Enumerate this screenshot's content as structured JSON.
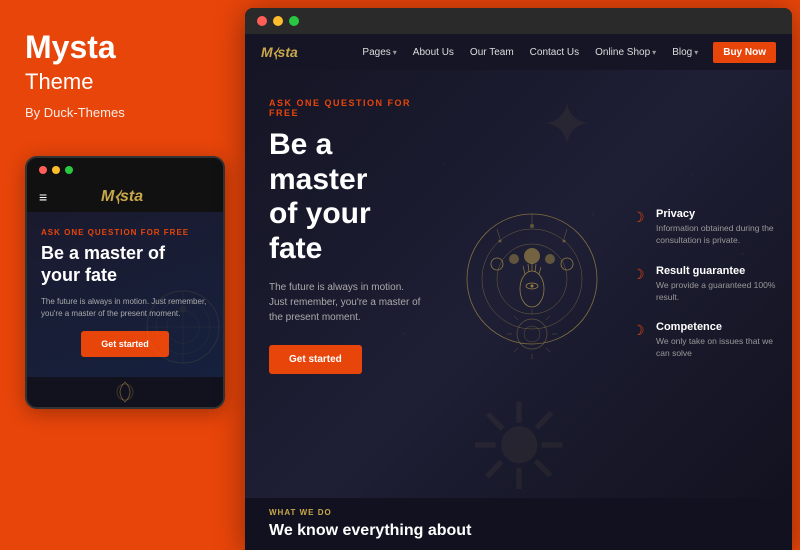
{
  "left": {
    "brand_title": "Mysta",
    "brand_subtitle": "Theme",
    "brand_author": "By Duck-Themes",
    "mobile": {
      "logo": "M⧼sta",
      "ask_label": "ASK ONE QUESTION FOR FREE",
      "hero_title": "Be a master of your fate",
      "hero_desc": "The future is always in motion. Just remember, you're a master of the present moment.",
      "cta_label": "Get started"
    }
  },
  "right": {
    "browser_dots": [
      "red",
      "yellow",
      "green"
    ],
    "nav": {
      "logo": "M⧼sta",
      "links": [
        {
          "label": "Pages",
          "has_dropdown": true
        },
        {
          "label": "About Us",
          "has_dropdown": false
        },
        {
          "label": "Our Team",
          "has_dropdown": false
        },
        {
          "label": "Contact Us",
          "has_dropdown": false
        },
        {
          "label": "Online Shop",
          "has_dropdown": true
        },
        {
          "label": "Blog",
          "has_dropdown": true
        }
      ],
      "buy_btn": "Buy Now"
    },
    "hero": {
      "ask_label": "ASK ONE QUESTION FOR FREE",
      "title_line1": "Be a master",
      "title_line2": "of your fate",
      "description": "The future is always in motion. Just remember, you're a master of the present moment.",
      "cta_label": "Get started"
    },
    "features": [
      {
        "icon": "☽",
        "title": "Privacy",
        "desc": "Information obtained during the consultation is private."
      },
      {
        "icon": "☽",
        "title": "Result guarantee",
        "desc": "We provide a guaranteed 100% result."
      },
      {
        "icon": "☽",
        "title": "Competence",
        "desc": "We only take on issues that we can solve"
      }
    ],
    "bottom": {
      "label": "WHAT WE DO",
      "heading": "We know everything about"
    }
  },
  "colors": {
    "accent": "#e8450a",
    "gold": "#c8a84b",
    "dark_bg": "#1a1a2e",
    "text_light": "#ffffff",
    "text_muted": "#999999"
  }
}
